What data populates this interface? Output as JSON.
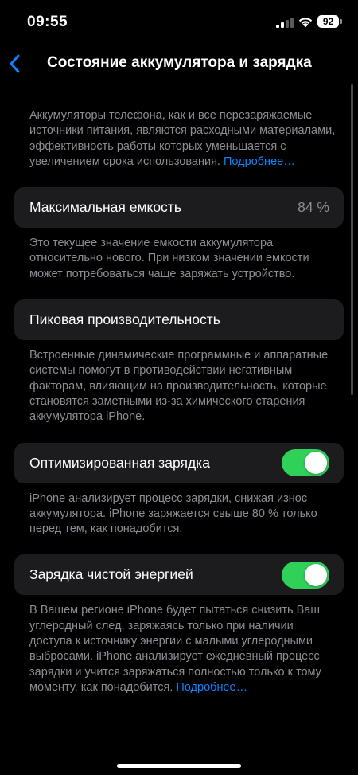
{
  "status_bar": {
    "time": "09:55",
    "battery_level": "92",
    "icons": [
      "cellular-signal-icon",
      "wifi-icon",
      "battery-icon"
    ]
  },
  "nav": {
    "back_icon": "chevron-left-icon",
    "title": "Состояние аккумулятора и зарядка"
  },
  "colors": {
    "accent": "#0a84ff",
    "toggle_on": "#30d158",
    "card_bg": "#1c1c1e",
    "secondary_text": "#8d8d93"
  },
  "intro": {
    "text": "Аккумуляторы телефона, как и все перезаряжаемые источники питания, являются расходными материалами, эффективность работы которых уменьшается с увеличением срока использования. ",
    "link": "Подробнее…"
  },
  "max_capacity": {
    "label": "Максимальная емкость",
    "value": "84 %",
    "description": "Это текущее значение емкости аккумулятора относительно нового. При низком значении емкости может потребоваться чаще заряжать устройство."
  },
  "peak_performance": {
    "label": "Пиковая производительность",
    "description": "Встроенные динамические программные и аппаратные системы помогут в противодействии негативным факторам, влияющим на производительность, которые становятся заметными из-за химического старения аккумулятора iPhone."
  },
  "optimized_charging": {
    "label": "Оптимизированная зарядка",
    "enabled": true,
    "description": "iPhone анализирует процесс зарядки, снижая износ аккумулятора. iPhone заряжается свыше 80 % только перед тем, как понадобится."
  },
  "clean_energy": {
    "label": "Зарядка чистой энергией",
    "enabled": true,
    "description": "В Вашем регионе iPhone будет пытаться снизить Ваш углеродный след, заряжаясь только при наличии доступа к источнику энергии с малыми углеродными выбросами. iPhone анализирует ежедневный процесс зарядки и учится заряжаться полностью только к тому моменту, как понадобится. ",
    "link": "Подробнее…"
  }
}
